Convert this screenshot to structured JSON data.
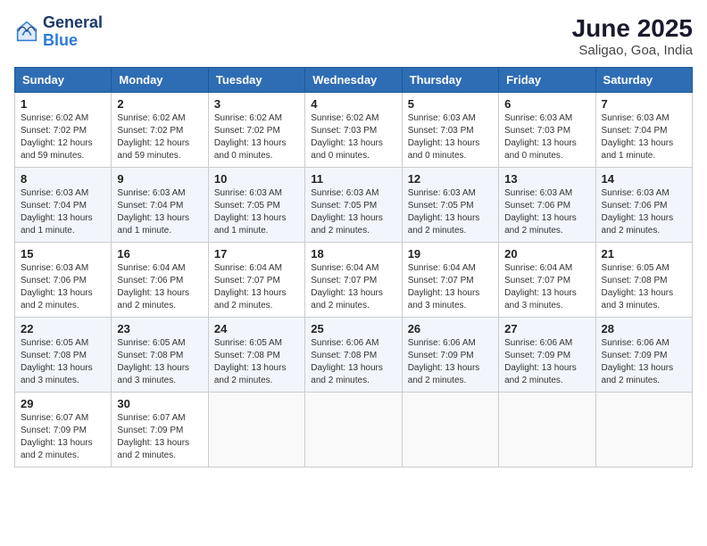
{
  "logo": {
    "general": "General",
    "blue": "Blue"
  },
  "title": "June 2025",
  "subtitle": "Saligao, Goa, India",
  "weekdays": [
    "Sunday",
    "Monday",
    "Tuesday",
    "Wednesday",
    "Thursday",
    "Friday",
    "Saturday"
  ],
  "weeks": [
    [
      {
        "day": "1",
        "info": "Sunrise: 6:02 AM\nSunset: 7:02 PM\nDaylight: 12 hours\nand 59 minutes."
      },
      {
        "day": "2",
        "info": "Sunrise: 6:02 AM\nSunset: 7:02 PM\nDaylight: 12 hours\nand 59 minutes."
      },
      {
        "day": "3",
        "info": "Sunrise: 6:02 AM\nSunset: 7:02 PM\nDaylight: 13 hours\nand 0 minutes."
      },
      {
        "day": "4",
        "info": "Sunrise: 6:02 AM\nSunset: 7:03 PM\nDaylight: 13 hours\nand 0 minutes."
      },
      {
        "day": "5",
        "info": "Sunrise: 6:03 AM\nSunset: 7:03 PM\nDaylight: 13 hours\nand 0 minutes."
      },
      {
        "day": "6",
        "info": "Sunrise: 6:03 AM\nSunset: 7:03 PM\nDaylight: 13 hours\nand 0 minutes."
      },
      {
        "day": "7",
        "info": "Sunrise: 6:03 AM\nSunset: 7:04 PM\nDaylight: 13 hours\nand 1 minute."
      }
    ],
    [
      {
        "day": "8",
        "info": "Sunrise: 6:03 AM\nSunset: 7:04 PM\nDaylight: 13 hours\nand 1 minute."
      },
      {
        "day": "9",
        "info": "Sunrise: 6:03 AM\nSunset: 7:04 PM\nDaylight: 13 hours\nand 1 minute."
      },
      {
        "day": "10",
        "info": "Sunrise: 6:03 AM\nSunset: 7:05 PM\nDaylight: 13 hours\nand 1 minute."
      },
      {
        "day": "11",
        "info": "Sunrise: 6:03 AM\nSunset: 7:05 PM\nDaylight: 13 hours\nand 2 minutes."
      },
      {
        "day": "12",
        "info": "Sunrise: 6:03 AM\nSunset: 7:05 PM\nDaylight: 13 hours\nand 2 minutes."
      },
      {
        "day": "13",
        "info": "Sunrise: 6:03 AM\nSunset: 7:06 PM\nDaylight: 13 hours\nand 2 minutes."
      },
      {
        "day": "14",
        "info": "Sunrise: 6:03 AM\nSunset: 7:06 PM\nDaylight: 13 hours\nand 2 minutes."
      }
    ],
    [
      {
        "day": "15",
        "info": "Sunrise: 6:03 AM\nSunset: 7:06 PM\nDaylight: 13 hours\nand 2 minutes."
      },
      {
        "day": "16",
        "info": "Sunrise: 6:04 AM\nSunset: 7:06 PM\nDaylight: 13 hours\nand 2 minutes."
      },
      {
        "day": "17",
        "info": "Sunrise: 6:04 AM\nSunset: 7:07 PM\nDaylight: 13 hours\nand 2 minutes."
      },
      {
        "day": "18",
        "info": "Sunrise: 6:04 AM\nSunset: 7:07 PM\nDaylight: 13 hours\nand 2 minutes."
      },
      {
        "day": "19",
        "info": "Sunrise: 6:04 AM\nSunset: 7:07 PM\nDaylight: 13 hours\nand 3 minutes."
      },
      {
        "day": "20",
        "info": "Sunrise: 6:04 AM\nSunset: 7:07 PM\nDaylight: 13 hours\nand 3 minutes."
      },
      {
        "day": "21",
        "info": "Sunrise: 6:05 AM\nSunset: 7:08 PM\nDaylight: 13 hours\nand 3 minutes."
      }
    ],
    [
      {
        "day": "22",
        "info": "Sunrise: 6:05 AM\nSunset: 7:08 PM\nDaylight: 13 hours\nand 3 minutes."
      },
      {
        "day": "23",
        "info": "Sunrise: 6:05 AM\nSunset: 7:08 PM\nDaylight: 13 hours\nand 3 minutes."
      },
      {
        "day": "24",
        "info": "Sunrise: 6:05 AM\nSunset: 7:08 PM\nDaylight: 13 hours\nand 2 minutes."
      },
      {
        "day": "25",
        "info": "Sunrise: 6:06 AM\nSunset: 7:08 PM\nDaylight: 13 hours\nand 2 minutes."
      },
      {
        "day": "26",
        "info": "Sunrise: 6:06 AM\nSunset: 7:09 PM\nDaylight: 13 hours\nand 2 minutes."
      },
      {
        "day": "27",
        "info": "Sunrise: 6:06 AM\nSunset: 7:09 PM\nDaylight: 13 hours\nand 2 minutes."
      },
      {
        "day": "28",
        "info": "Sunrise: 6:06 AM\nSunset: 7:09 PM\nDaylight: 13 hours\nand 2 minutes."
      }
    ],
    [
      {
        "day": "29",
        "info": "Sunrise: 6:07 AM\nSunset: 7:09 PM\nDaylight: 13 hours\nand 2 minutes."
      },
      {
        "day": "30",
        "info": "Sunrise: 6:07 AM\nSunset: 7:09 PM\nDaylight: 13 hours\nand 2 minutes."
      },
      {
        "day": "",
        "info": ""
      },
      {
        "day": "",
        "info": ""
      },
      {
        "day": "",
        "info": ""
      },
      {
        "day": "",
        "info": ""
      },
      {
        "day": "",
        "info": ""
      }
    ]
  ]
}
